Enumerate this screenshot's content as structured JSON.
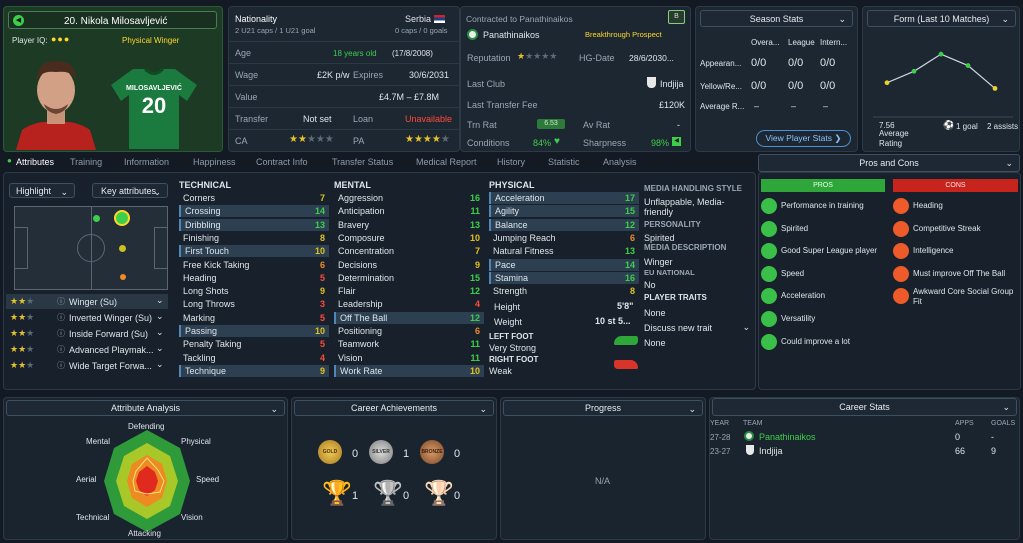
{
  "player": {
    "number_name": "20. Nikola Milosavljević",
    "iq_label": "Player IQ:",
    "role": "Physical Winger",
    "shirt_name": "MILOSAVLJEVIĆ",
    "shirt_number": "20"
  },
  "info": {
    "nationality_label": "Nationality",
    "nationality": "Serbia",
    "caps": "2 U21 caps / 1 U21 goal",
    "caps_right": "0 caps / 0 goals",
    "age_label": "Age",
    "age": "18 years old",
    "dob": "(17/8/2008)",
    "wage_label": "Wage",
    "wage": "£2K p/w",
    "expires_label": "Expires",
    "expires": "30/6/2031",
    "value_label": "Value",
    "value": "£4.7M – £7.8M",
    "transfer_label": "Transfer",
    "transfer": "Not set",
    "loan_label": "Loan",
    "loan": "Unavailable",
    "ca_label": "CA",
    "pa_label": "PA"
  },
  "contract": {
    "title": "Contracted to Panathinaikos",
    "badge": "B",
    "club": "Panathinaikos",
    "prospect": "Breakthrough Prospect",
    "reputation_label": "Reputation",
    "hg_label": "HG-Date",
    "hg": "28/6/2030...",
    "last_club_label": "Last Club",
    "last_club": "Indjija",
    "last_fee_label": "Last Transfer Fee",
    "last_fee": "£120K",
    "trn_label": "Trn Rat",
    "trn": "6.53",
    "av_label": "Av Rat",
    "av": "-",
    "cond_label": "Conditions",
    "cond": "84%",
    "sharp_label": "Sharpness",
    "sharp": "98%"
  },
  "season": {
    "title": "Season Stats",
    "cols": [
      "Overa...",
      "League",
      "Intern..."
    ],
    "rows": [
      {
        "label": "Appearan...",
        "vals": [
          "0/0",
          "0/0",
          "0/0"
        ]
      },
      {
        "label": "Yellow/Re...",
        "vals": [
          "0/0",
          "0/0",
          "0/0"
        ]
      },
      {
        "label": "Average R...",
        "vals": [
          "–",
          "–",
          "–"
        ]
      }
    ],
    "button": "View Player Stats ❯"
  },
  "form": {
    "title": "Form (Last 10 Matches)",
    "values": [
      7.4,
      7.6,
      7.9,
      7.7,
      7.3
    ],
    "avg": "7.56",
    "avg_label": "Average Rating",
    "goals": "1 goal",
    "assists": "2 assists"
  },
  "tabs": [
    "Attributes",
    "Training",
    "Information",
    "Happiness",
    "Contract Info",
    "Transfer Status",
    "Medical Report",
    "History",
    "Statistic",
    "Analysis"
  ],
  "pros_cons": {
    "title": "Pros and Cons",
    "pros_label": "PROS",
    "cons_label": "CONS",
    "pros": [
      "Performance in training",
      "Spirited",
      "Good Super League player",
      "Speed",
      "Acceleration",
      "Versatility",
      "Could improve a lot"
    ],
    "cons": [
      "Heading",
      "Competitive Streak",
      "Intelligence",
      "Must improve Off The Ball",
      "Awkward Core Social Group Fit"
    ]
  },
  "controls": {
    "highlight": "Highlight",
    "key": "Key attributes"
  },
  "roles": [
    {
      "stars": 2,
      "name": "Winger (Su)"
    },
    {
      "stars": 2,
      "name": "Inverted Winger (Su)"
    },
    {
      "stars": 2,
      "name": "Inside Forward (Su)"
    },
    {
      "stars": 1.5,
      "name": "Advanced Playmak..."
    },
    {
      "stars": 1.5,
      "name": "Wide Target Forwa..."
    }
  ],
  "technical": {
    "title": "TECHNICAL",
    "items": [
      {
        "n": "Corners",
        "v": "7",
        "c": "#e0c21e",
        "h": false
      },
      {
        "n": "Crossing",
        "v": "14",
        "c": "#3ecf4a",
        "h": true
      },
      {
        "n": "Dribbling",
        "v": "13",
        "c": "#3ecf4a",
        "h": true
      },
      {
        "n": "Finishing",
        "v": "8",
        "c": "#e0c21e",
        "h": false
      },
      {
        "n": "First Touch",
        "v": "10",
        "c": "#e0c21e",
        "h": true
      },
      {
        "n": "Free Kick Taking",
        "v": "6",
        "c": "#f08a2a",
        "h": false
      },
      {
        "n": "Heading",
        "v": "5",
        "c": "#ff4a3a",
        "h": false
      },
      {
        "n": "Long Shots",
        "v": "9",
        "c": "#e0c21e",
        "h": false
      },
      {
        "n": "Long Throws",
        "v": "3",
        "c": "#ff4a3a",
        "h": false
      },
      {
        "n": "Marking",
        "v": "5",
        "c": "#ff4a3a",
        "h": false
      },
      {
        "n": "Passing",
        "v": "10",
        "c": "#e0c21e",
        "h": true
      },
      {
        "n": "Penalty Taking",
        "v": "5",
        "c": "#ff4a3a",
        "h": false
      },
      {
        "n": "Tackling",
        "v": "4",
        "c": "#ff4a3a",
        "h": false
      },
      {
        "n": "Technique",
        "v": "9",
        "c": "#e0c21e",
        "h": true
      }
    ]
  },
  "mental": {
    "title": "MENTAL",
    "items": [
      {
        "n": "Aggression",
        "v": "16",
        "c": "#3ecf4a",
        "h": false
      },
      {
        "n": "Anticipation",
        "v": "11",
        "c": "#3ecf4a",
        "h": false
      },
      {
        "n": "Bravery",
        "v": "13",
        "c": "#3ecf4a",
        "h": false
      },
      {
        "n": "Composure",
        "v": "10",
        "c": "#e0c21e",
        "h": false
      },
      {
        "n": "Concentration",
        "v": "7",
        "c": "#e0c21e",
        "h": false
      },
      {
        "n": "Decisions",
        "v": "9",
        "c": "#e0c21e",
        "h": false
      },
      {
        "n": "Determination",
        "v": "15",
        "c": "#3ecf4a",
        "h": false
      },
      {
        "n": "Flair",
        "v": "12",
        "c": "#3ecf4a",
        "h": false
      },
      {
        "n": "Leadership",
        "v": "4",
        "c": "#ff4a3a",
        "h": false
      },
      {
        "n": "Off The Ball",
        "v": "12",
        "c": "#3ecf4a",
        "h": true
      },
      {
        "n": "Positioning",
        "v": "6",
        "c": "#f08a2a",
        "h": false
      },
      {
        "n": "Teamwork",
        "v": "11",
        "c": "#3ecf4a",
        "h": false
      },
      {
        "n": "Vision",
        "v": "11",
        "c": "#3ecf4a",
        "h": false
      },
      {
        "n": "Work Rate",
        "v": "10",
        "c": "#e0c21e",
        "h": true
      }
    ]
  },
  "physical": {
    "title": "PHYSICAL",
    "items": [
      {
        "n": "Acceleration",
        "v": "17",
        "c": "#3ecf4a",
        "h": true
      },
      {
        "n": "Agility",
        "v": "15",
        "c": "#3ecf4a",
        "h": true
      },
      {
        "n": "Balance",
        "v": "12",
        "c": "#3ecf4a",
        "h": true
      },
      {
        "n": "Jumping Reach",
        "v": "6",
        "c": "#f08a2a",
        "h": false
      },
      {
        "n": "Natural Fitness",
        "v": "13",
        "c": "#3ecf4a",
        "h": false
      },
      {
        "n": "Pace",
        "v": "14",
        "c": "#3ecf4a",
        "h": true
      },
      {
        "n": "Stamina",
        "v": "16",
        "c": "#3ecf4a",
        "h": true
      },
      {
        "n": "Strength",
        "v": "8",
        "c": "#e0c21e",
        "h": false
      }
    ],
    "height_label": "Height",
    "height": "5'8\"",
    "weight_label": "Weight",
    "weight": "10 st 5...",
    "left_foot_label": "LEFT FOOT",
    "left_foot": "Very Strong",
    "right_foot_label": "RIGHT FOOT",
    "right_foot": "Weak"
  },
  "media": {
    "style_label": "MEDIA HANDLING STYLE",
    "style": "Unflappable, Media-friendly",
    "personality_label": "PERSONALITY",
    "personality": "Spirited",
    "desc_label": "MEDIA DESCRIPTION",
    "desc": "Winger",
    "eu_label": "EU NATIONAL",
    "eu": "No",
    "traits_label": "PLAYER TRAITS",
    "traits": "None",
    "discuss": "Discuss new trait",
    "none2": "None"
  },
  "bottom": {
    "analysis": {
      "title": "Attribute Analysis",
      "labels": [
        "Defending",
        "Physical",
        "Speed",
        "Vision",
        "Attacking",
        "Technical",
        "Aerial",
        "Mental"
      ]
    },
    "achievements": {
      "title": "Career Achievements",
      "medal_counts": [
        "0",
        "1",
        "0"
      ],
      "medal_names": [
        "GOLD",
        "SILVER",
        "BRONZE"
      ],
      "trophy_counts": [
        "1",
        "0",
        "0"
      ]
    },
    "progress": {
      "title": "Progress",
      "na": "N/A"
    },
    "career": {
      "title": "Career Stats",
      "headers": [
        "YEAR",
        "TEAM",
        "APPS",
        "GOALS"
      ],
      "rows": [
        {
          "year": "27-28",
          "team": "Panathinaikos",
          "apps": "0",
          "goals": "-"
        },
        {
          "year": "23-27",
          "team": "Indjija",
          "apps": "66",
          "goals": "9"
        }
      ]
    }
  }
}
